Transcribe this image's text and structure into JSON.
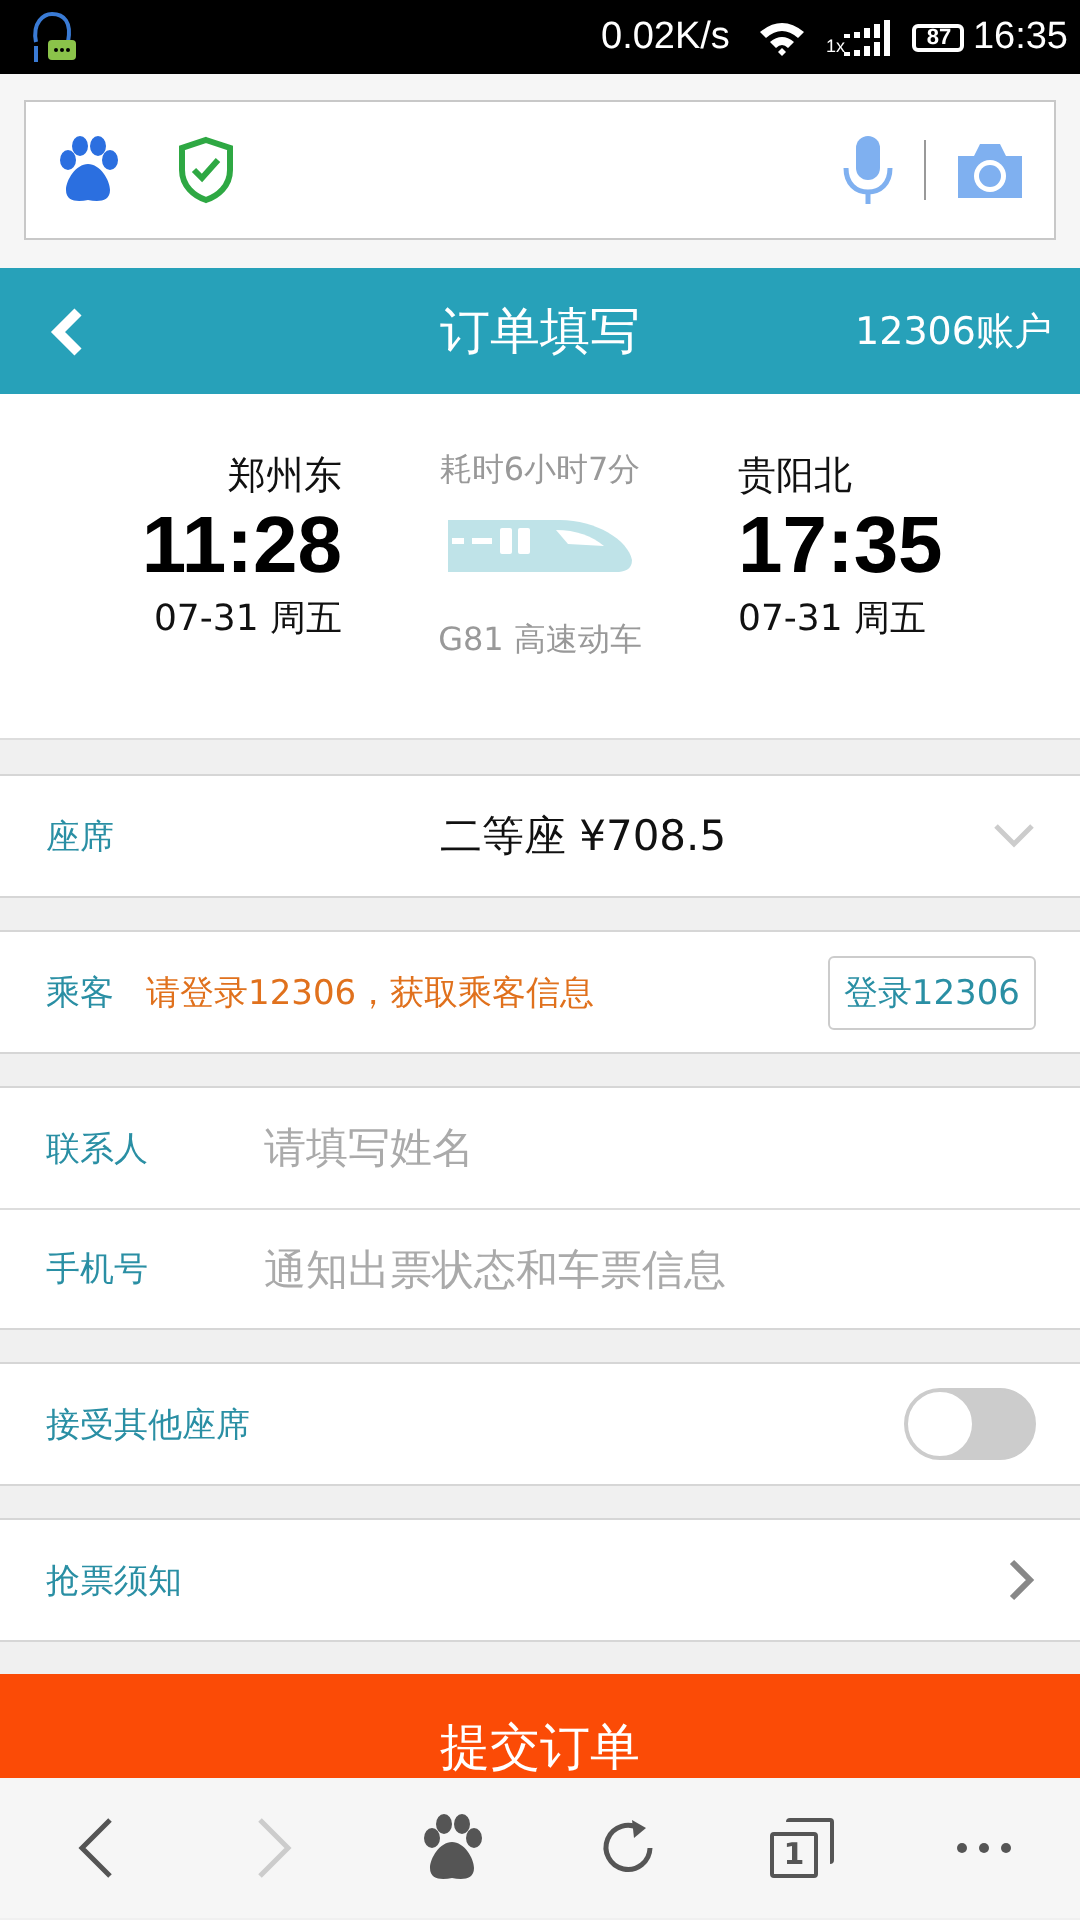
{
  "status_bar": {
    "speed": "0.02K/s",
    "network": "1x",
    "battery": "87",
    "time": "16:35"
  },
  "header": {
    "title": "订单填写",
    "account": "12306账户"
  },
  "trip": {
    "from": {
      "station": "郑州东",
      "time": "11:28",
      "date": "07-31 周五"
    },
    "duration": "耗时6小时7分",
    "train": "G81 高速动车",
    "to": {
      "station": "贵阳北",
      "time": "17:35",
      "date": "07-31 周五"
    }
  },
  "seat": {
    "label": "座席",
    "value": "二等座 ¥708.5"
  },
  "passenger": {
    "label": "乘客",
    "notice": "请登录12306，获取乘客信息",
    "button": "登录12306"
  },
  "contact": [
    {
      "label": "联系人",
      "placeholder": "请填写姓名"
    },
    {
      "label": "手机号",
      "placeholder": "通知出票状态和车票信息"
    }
  ],
  "accept_other_seats": {
    "label": "接受其他座席",
    "on": false
  },
  "ticket_notice": {
    "label": "抢票须知"
  },
  "submit": {
    "label": "提交订单"
  },
  "bottom_nav": {
    "back_disabled": false,
    "forward_disabled": true,
    "tabs_count": "1"
  }
}
